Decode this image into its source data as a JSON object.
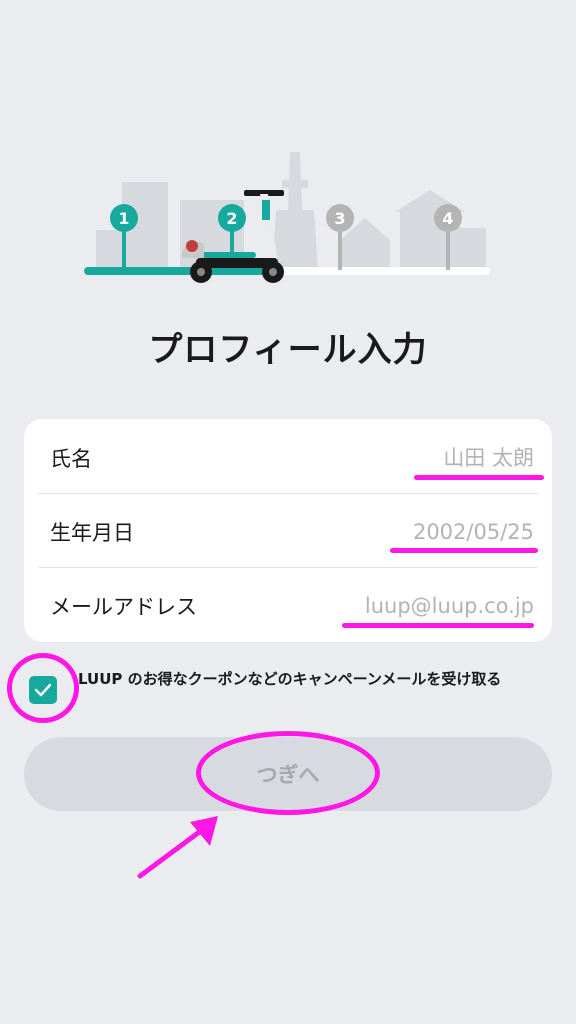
{
  "progress": {
    "steps": [
      "1",
      "2",
      "3",
      "4"
    ],
    "current_step": 2,
    "active_color": "#17a99e",
    "inactive_color": "#b4b4b4"
  },
  "page_title": "プロフィール入力",
  "form": {
    "name_label": "氏名",
    "name_placeholder": "山田 太朗",
    "birthdate_label": "生年月日",
    "birthdate_placeholder": "2002/05/25",
    "email_label": "メールアドレス",
    "email_placeholder": "luup@luup.co.jp"
  },
  "consent": {
    "checked": true,
    "text": "LUUP のお得なクーポンなどのキャンペーンメールを受け取る"
  },
  "next_button_label": "つぎへ",
  "annotation_color": "#ff17e6"
}
